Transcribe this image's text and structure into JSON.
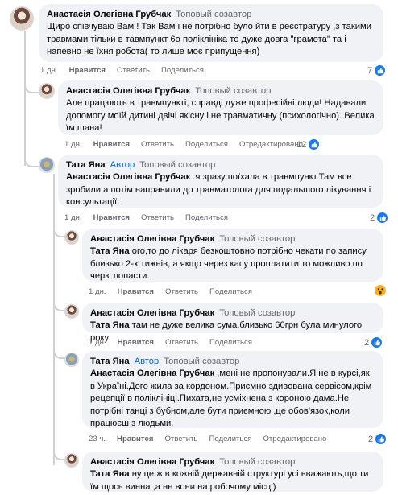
{
  "labels": {
    "top_fan": "Топовый созавтор",
    "author": "Автор",
    "like": "Нравится",
    "reply": "Ответить",
    "share": "Поделиться",
    "edited": "Отредактировано"
  },
  "comments": [
    {
      "name": "Анастасія Олегівна Грубчак",
      "mention": "",
      "text": "Щиро співчуваю Вам ! Так Вам і не потрібно було йти в реєстратуру ,з такими травмами тільки в тавмпункт 6о поліклініка то дуже довга \"грамота\" та і напевно не їхня робота( то лише моє припущення)",
      "time": "1 дн.",
      "reactions": "7",
      "reaction_type": "like"
    },
    {
      "name": "Анастасія Олегівна Грубчак",
      "mention": "",
      "text": "Але працюють в травмпункті, справді дуже професійні люди! Надавали допомогу моїй дитині двічі якісну і не травматичну (психологічно). Велика їм шана!",
      "time": "1 дн.",
      "reactions": "12",
      "reaction_type": "like"
    },
    {
      "name": "Тата Яна",
      "mention": "Анастасія Олегівна Грубчак",
      "text": " .я зразу поїхала в травмпункт.Там все зробили.а потім направили до травматолога для подальшого лікування і консультації.",
      "time": "1 дн.",
      "reactions": "2",
      "reaction_type": "like"
    },
    {
      "name": "Анастасія Олегівна Грубчак",
      "mention": "Тата Яна",
      "text": " ого,то до лікаря безкоштовно потрібно чекати по запису близько 2-х тижнів, а якщо через касу проплатити то можливо по черзі попасти.",
      "time": "1 дн.",
      "reactions": "",
      "reaction_type": "wow"
    },
    {
      "name": "Анастасія Олегівна Грубчак",
      "mention": "Тата Яна",
      "text": " там не дуже велика сума,близько 60грн була минулого року",
      "time": "1 дн.",
      "reactions": "2",
      "reaction_type": "like"
    },
    {
      "name": "Тата Яна",
      "mention": "Анастасія Олегівна Грубчак",
      "text": " ,мені не пропонували.Я не в курсі,як в Україні.Дого жила за кордоном.Приємно здивована сервісом,крім рецепції в поліклініці.Пихата,не усміхнена з короною дама.Не потрібні танці з бубном,але бути приємною ,це обов'язок,коли працюєш з людьми.",
      "time": "23 ч.",
      "reactions": "2",
      "reaction_type": "like"
    },
    {
      "name": "Анастасія Олегівна Грубчак",
      "mention": "Тата Яна",
      "text": " ну це ж в кожній державній структурі усі вважають,що ти їм щось винна ,а не вони на робочому місці)",
      "time": "",
      "reactions": "",
      "reaction_type": ""
    }
  ]
}
